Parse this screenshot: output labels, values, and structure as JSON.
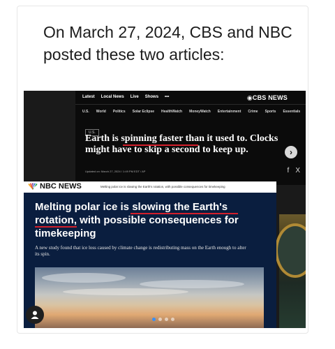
{
  "post": {
    "text": "On March 27, 2024, CBS and NBC posted these two articles:"
  },
  "cbs": {
    "nav": [
      "Latest",
      "Local News",
      "Live",
      "Shows",
      "•••"
    ],
    "logo": "CBS NEWS",
    "subnav": [
      "U.S.",
      "World",
      "Politics",
      "Solar Eclipse",
      "HealthWatch",
      "MoneyWatch",
      "Entertainment",
      "Crime",
      "Sports",
      "Essentials"
    ],
    "tag": "U.S.",
    "headline": "Earth is spinning faster than it used to. Clocks might have to skip a second to keep up.",
    "date": "Updated on: March 27, 2024 / 1:49 PM EDT / AP",
    "social": [
      "f",
      "X"
    ]
  },
  "nbc": {
    "logo": "NBC NEWS",
    "ticker": "Melting polar ice is slowing the Earth's rotation, with possible consequences for timekeeping",
    "headline": "Melting polar ice is slowing the Earth's rotation, with possible consequences for timekeeping",
    "dek": "A new study found that ice loss caused by climate change is redistributing mass on the Earth enough to alter its spin."
  },
  "carousel": {
    "current": 1,
    "total": 4
  },
  "colors": {
    "underline": "#d41f2b",
    "nbc_bg": "#0a1e3f",
    "indicator_active": "#3b8ff2"
  }
}
